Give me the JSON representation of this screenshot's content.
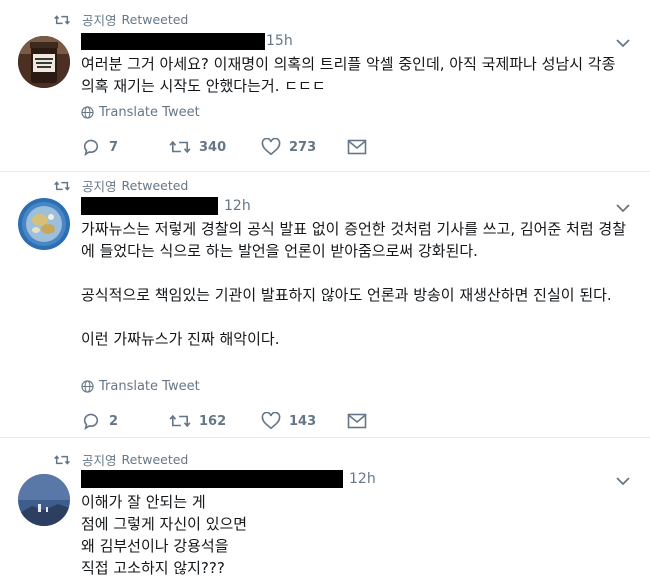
{
  "tweets": [
    {
      "retweeter": "공지영",
      "retweeted_label": "Retweeted",
      "time": "15h",
      "paragraphs": [
        "여러분 그거 아세요? 이재명이 의혹의 트리플 악셀 중인데, 아직 국제파나 성남시 각종 의혹 재기는 시작도 안했다는거. ㄷㄷㄷ"
      ],
      "translate": "Translate Tweet",
      "replies": "7",
      "retweets": "340",
      "likes": "273",
      "avatar_jar_text": "GIFT & GARAGE CHUTNEY"
    },
    {
      "retweeter": "공지영",
      "retweeted_label": "Retweeted",
      "time": "12h",
      "paragraphs": [
        "가짜뉴스는 저렇게 경찰의 공식 발표 없이 증언한 것처럼 기사를 쓰고, 김어준 처럼 경찰에 들었다는 식으로 하는 발언을 언론이 받아줌으로써 강화된다.",
        "공식적으로 책임있는 기관이 발표하지 않아도 언론과 방송이 재생산하면 진실이 된다.",
        "이런 가짜뉴스가 진짜 해악이다."
      ],
      "translate": "Translate Tweet",
      "replies": "2",
      "retweets": "162",
      "likes": "143"
    },
    {
      "retweeter": "공지영",
      "retweeted_label": "Retweeted",
      "time": "12h",
      "lines": [
        "이해가 잘 안되는 게",
        "점에 그렇게 자신이 있으면",
        "왜 김부선이나 강용석을",
        "직접 고소하지 않지???"
      ]
    }
  ],
  "colors": {
    "meta": "#657786",
    "text": "#14171a",
    "divider": "#e6ecf0",
    "redaction": "#000000"
  }
}
